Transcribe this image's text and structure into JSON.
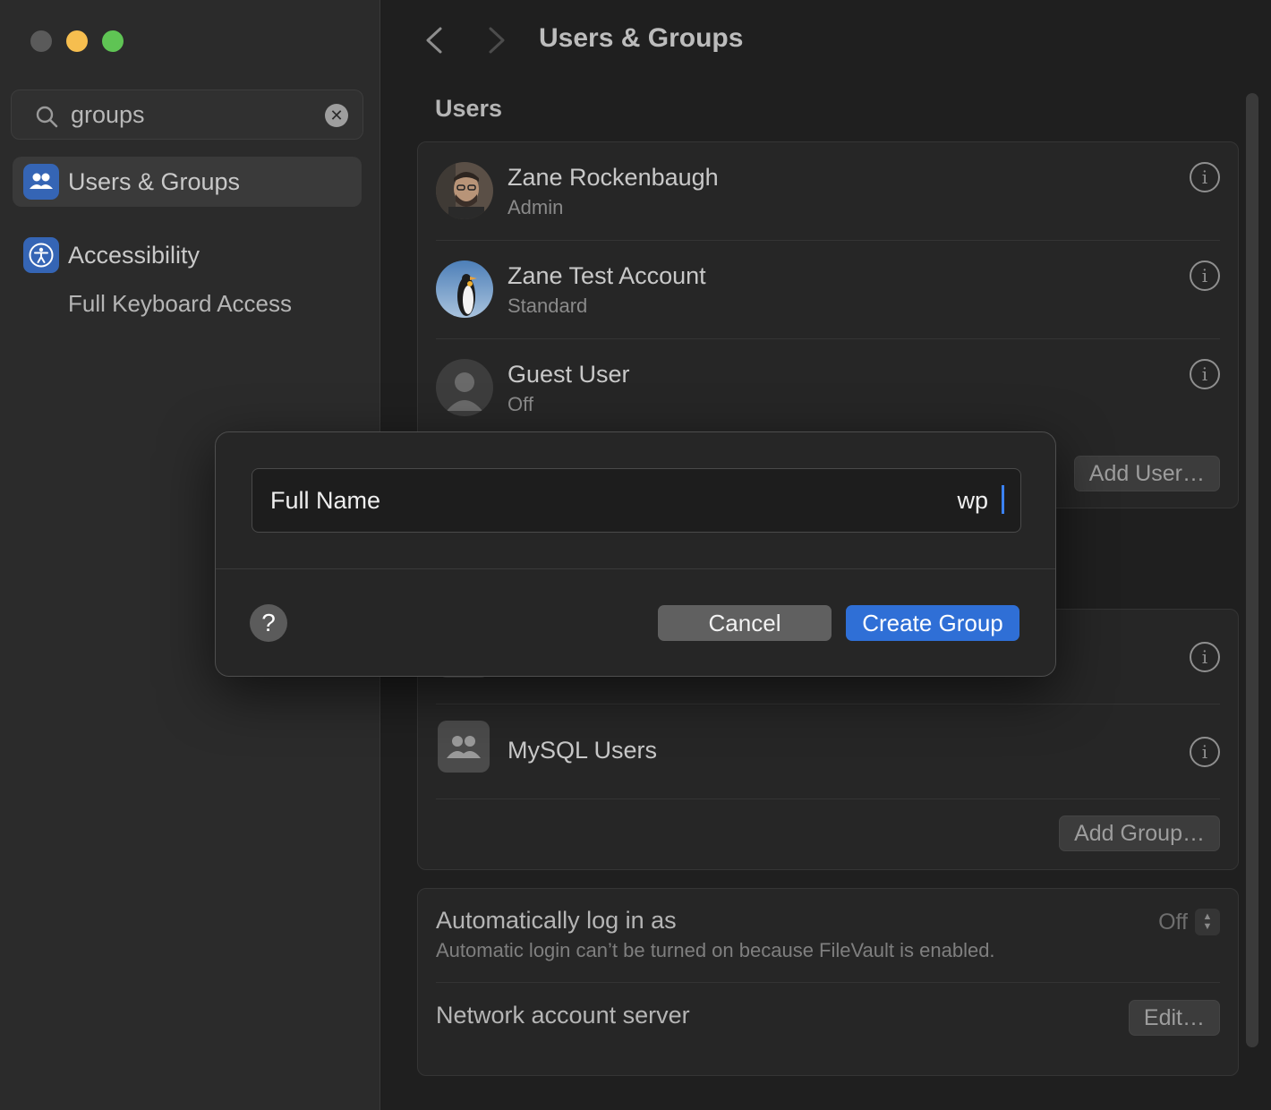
{
  "sidebar": {
    "search": {
      "value": "groups"
    },
    "items": [
      {
        "label": "Users & Groups",
        "active": true
      },
      {
        "label": "Accessibility",
        "active": false
      }
    ],
    "sub_items": [
      {
        "label": "Full Keyboard Access"
      }
    ]
  },
  "header": {
    "title": "Users & Groups"
  },
  "users": {
    "section_title": "Users",
    "list": [
      {
        "name": "Zane Rockenbaugh",
        "role": "Admin"
      },
      {
        "name": "Zane Test Account",
        "role": "Standard"
      },
      {
        "name": "Guest User",
        "role": "Off"
      }
    ],
    "add_button": "Add User…"
  },
  "groups": {
    "list": [
      {
        "name": "MySQL Users"
      }
    ],
    "add_button": "Add Group…"
  },
  "settings": {
    "auto_login": {
      "title": "Automatically log in as",
      "subtitle": "Automatic login can’t be turned on because FileVault is enabled.",
      "value": "Off"
    },
    "network_server": {
      "title": "Network account server",
      "button": "Edit…"
    }
  },
  "dialog": {
    "field_label": "Full Name",
    "field_value": "wp",
    "help": "?",
    "cancel": "Cancel",
    "create": "Create Group"
  },
  "colors": {
    "accent": "#2f6fd6",
    "caret": "#3b82f6",
    "traffic_min": "#f6be4f",
    "traffic_max": "#5fc454"
  }
}
